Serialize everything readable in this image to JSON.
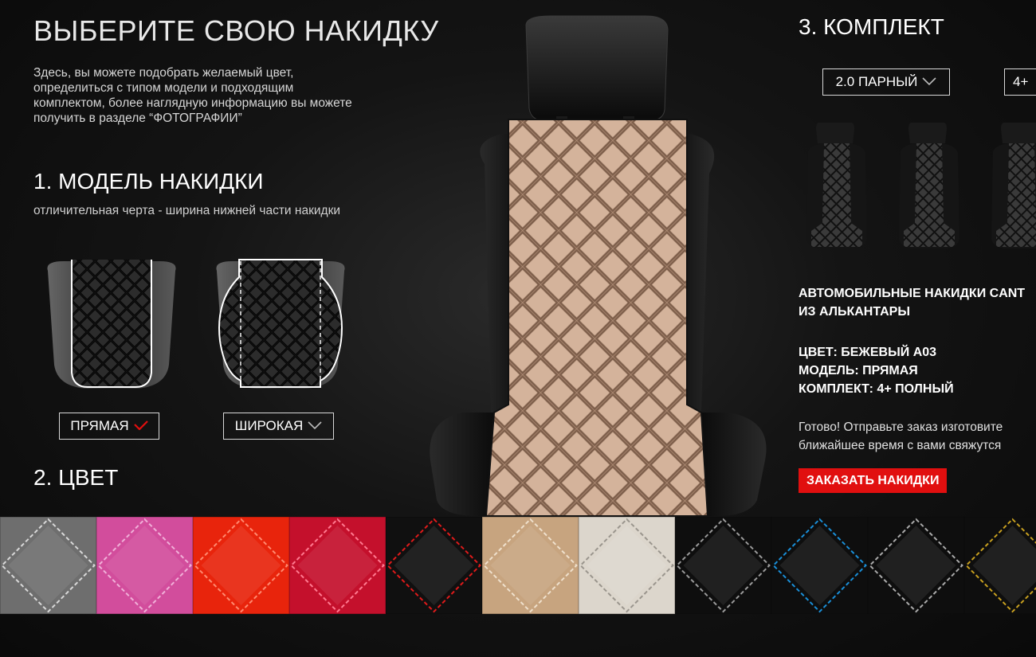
{
  "page": {
    "title": "ВЫБЕРИТЕ СВОЮ НАКИДКУ",
    "description": "Здесь, вы можете подобрать желаемый цвет, определиться с типом модели и подходящим комплектом, более наглядную информацию вы можете получить в разделе “ФОТОГРАФИИ”"
  },
  "model_section": {
    "heading": "1. МОДЕЛЬ НАКИДКИ",
    "subtitle": "отличительная черта - ширина нижней части накидки",
    "options": [
      {
        "label": "ПРЯМАЯ",
        "selected": true,
        "icon": "check-icon"
      },
      {
        "label": "ШИРОКАЯ",
        "selected": false,
        "icon": "chevron-down-icon"
      }
    ]
  },
  "color_section": {
    "heading": "2. ЦВЕТ",
    "swatches": [
      {
        "base": "#6e6e6e",
        "stitch": "#d8d8d8"
      },
      {
        "base": "#d24d9c",
        "stitch": "#f0b0d8"
      },
      {
        "base": "#e8240c",
        "stitch": "#ff8a70"
      },
      {
        "base": "#c4102c",
        "stitch": "#ff7a90"
      },
      {
        "base": "#101010",
        "stitch": "#e01a1a"
      },
      {
        "base": "#c7a47f",
        "stitch": "#efe0cc"
      },
      {
        "base": "#dcd6cc",
        "stitch": "#9a958d"
      },
      {
        "base": "#0e0e0e",
        "stitch": "#9a9a9a"
      },
      {
        "base": "#0e0e0e",
        "stitch": "#1a8fd8"
      },
      {
        "base": "#0e0e0e",
        "stitch": "#aaaaaa"
      },
      {
        "base": "#0e0e0e",
        "stitch": "#c8a020"
      },
      {
        "base": "#2f55d8",
        "stitch": "#a8bcff"
      }
    ]
  },
  "kit_section": {
    "heading": "3. КОМПЛЕКТ",
    "options": [
      {
        "label": "2.0 ПАРНЫЙ",
        "icon": "chevron-down-icon"
      },
      {
        "label": "4+"
      }
    ]
  },
  "summary": {
    "product_line1": "АВТОМОБИЛЬНЫЕ НАКИДКИ CANT",
    "product_line2": "ИЗ АЛЬКАНТАРЫ",
    "color": "ЦВЕТ: БЕЖЕВЫЙ А03",
    "model": "МОДЕЛЬ: ПРЯМАЯ",
    "kit": "КОМПЛЕКТ: 4+ ПОЛНЫЙ",
    "ready_line1": "Готово! Отправьте заказ изготовите",
    "ready_line2": "ближайшее время с вами свяжутся",
    "order_button": "ЗАКАЗАТЬ НАКИДКИ"
  },
  "colors": {
    "accent": "#e10f0f",
    "seat_cover": "#c9a58c",
    "seat_black": "#0c0c0c"
  }
}
